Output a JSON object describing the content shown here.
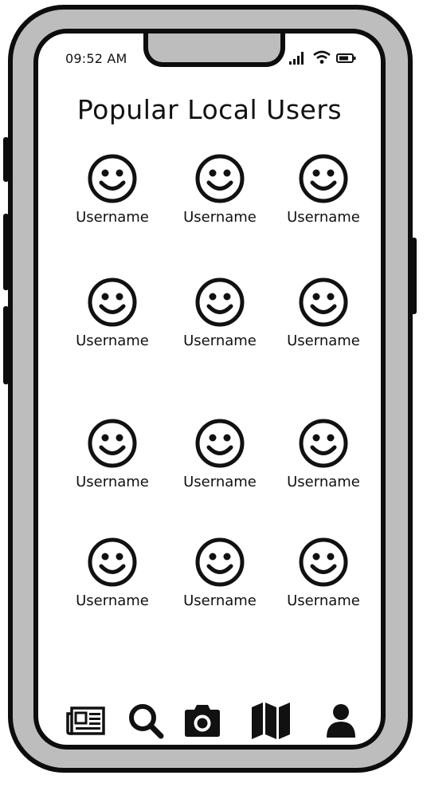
{
  "status_bar": {
    "time": "09:52 AM",
    "icons": [
      "cellular-signal-icon",
      "wifi-icon",
      "battery-icon"
    ]
  },
  "page": {
    "title": "Popular Local Users"
  },
  "users": [
    {
      "name": "Username",
      "icon": "smiley-avatar-icon"
    },
    {
      "name": "Username",
      "icon": "smiley-avatar-icon"
    },
    {
      "name": "Username",
      "icon": "smiley-avatar-icon"
    },
    {
      "name": "Username",
      "icon": "smiley-avatar-icon"
    },
    {
      "name": "Username",
      "icon": "smiley-avatar-icon"
    },
    {
      "name": "Username",
      "icon": "smiley-avatar-icon"
    },
    {
      "name": "Username",
      "icon": "smiley-avatar-icon"
    },
    {
      "name": "Username",
      "icon": "smiley-avatar-icon"
    },
    {
      "name": "Username",
      "icon": "smiley-avatar-icon"
    },
    {
      "name": "Username",
      "icon": "smiley-avatar-icon"
    },
    {
      "name": "Username",
      "icon": "smiley-avatar-icon"
    },
    {
      "name": "Username",
      "icon": "smiley-avatar-icon"
    }
  ],
  "bottom_nav": [
    {
      "icon": "newspaper-icon"
    },
    {
      "icon": "search-icon"
    },
    {
      "icon": "camera-icon"
    },
    {
      "icon": "map-icon"
    },
    {
      "icon": "profile-icon"
    }
  ],
  "colors": {
    "frame": "#0d0d0d",
    "bezel": "#bdbdbd",
    "screen": "#ffffff"
  }
}
